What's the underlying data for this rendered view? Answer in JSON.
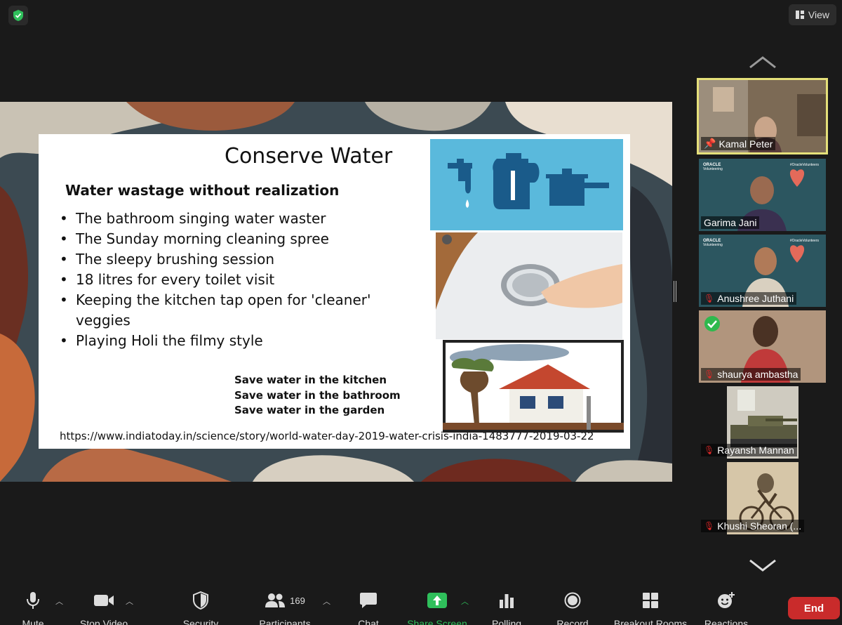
{
  "top": {
    "view_label": "View"
  },
  "slide": {
    "title": "Conserve Water",
    "subtitle": "Water wastage without realization",
    "bullets": [
      "The bathroom singing water waster",
      "The Sunday morning cleaning spree",
      "The sleepy brushing session",
      "18 litres for every toilet visit",
      "Keeping the kitchen tap open for 'cleaner' veggies",
      "Playing Holi the filmy style"
    ],
    "saves": [
      "Save water in the kitchen",
      "Save water in the bathroom",
      "Save water in the garden"
    ],
    "url": "https://www.indiatoday.in/science/story/world-water-day-2019-water-crisis-india-1483777-2019-03-22"
  },
  "participants": [
    {
      "name": "Kamal Peter",
      "pinned": true,
      "muted": false
    },
    {
      "name": "Garima Jani",
      "muted": false
    },
    {
      "name": "Anushree Juthani",
      "muted": true
    },
    {
      "name": "shaurya ambastha",
      "muted": true,
      "verified": true
    },
    {
      "name": "Rayansh Mannan",
      "muted": true
    },
    {
      "name": "Khushi Sheoran (...",
      "muted": true
    }
  ],
  "tile_text": {
    "oracle": "ORACLE",
    "volunteering": "Volunteering",
    "hashtag": "#OracleVolunteers"
  },
  "toolbar": {
    "mute": "Mute",
    "stop_video": "Stop Video",
    "security": "Security",
    "participants": "Participants",
    "participant_count": "169",
    "chat": "Chat",
    "share_screen": "Share Screen",
    "polling": "Polling",
    "record": "Record",
    "breakout_rooms": "Breakout Rooms",
    "reactions": "Reactions",
    "end": "End"
  },
  "colors": {
    "share_green": "#2fbf5b",
    "end_red": "#c92b2b",
    "active_outline": "#e5e07a"
  }
}
